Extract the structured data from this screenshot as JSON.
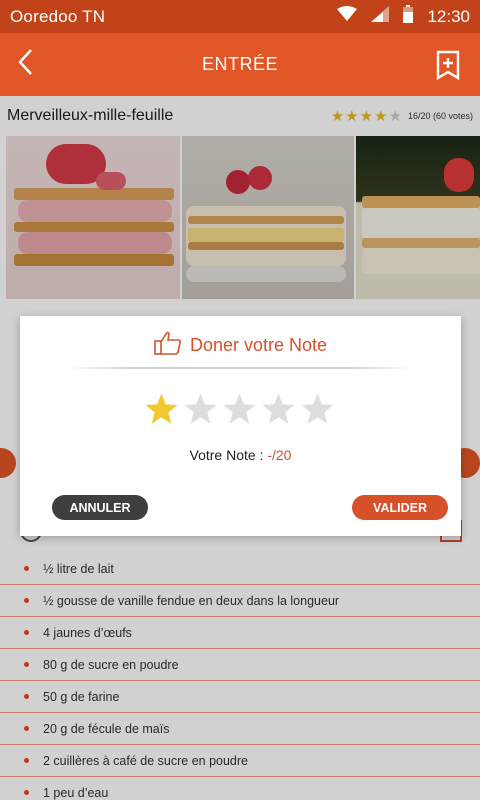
{
  "status_bar": {
    "carrier": "Ooredoo TN",
    "time": "12:30"
  },
  "app_bar": {
    "title": "ENTRÉE",
    "back_icon": "chevron-left-icon",
    "bookmark_icon": "bookmark-add-icon"
  },
  "recipe": {
    "title": "Merveilleux-mille-feuille",
    "rating_text": "16/20 (60 votes)",
    "rating_stars_filled": 4,
    "rating_stars_total": 5
  },
  "dialog": {
    "title": "Doner votre Note",
    "note_label": "Votre Note : ",
    "note_value": "-/20",
    "selected_stars": 1,
    "total_stars": 5,
    "cancel_label": "ANNULER",
    "ok_label": "VALIDER"
  },
  "ingredients": [
    "½ litre de lait",
    "½ gousse de vanille fendue en deux dans la longueur",
    "4 jaunes d’œufs",
    "80 g de sucre en poudre",
    "50 g de farine",
    "20 g de fécule de maïs",
    "2 cuillères à café de sucre en poudre",
    "1 peu d’eau"
  ],
  "colors": {
    "primary": "#e05626",
    "status": "#c2431a",
    "accent_text": "#d6502a",
    "star_active": "#f2c72f",
    "star_inactive": "#dddddd",
    "dark_button": "#3f3f3f"
  }
}
